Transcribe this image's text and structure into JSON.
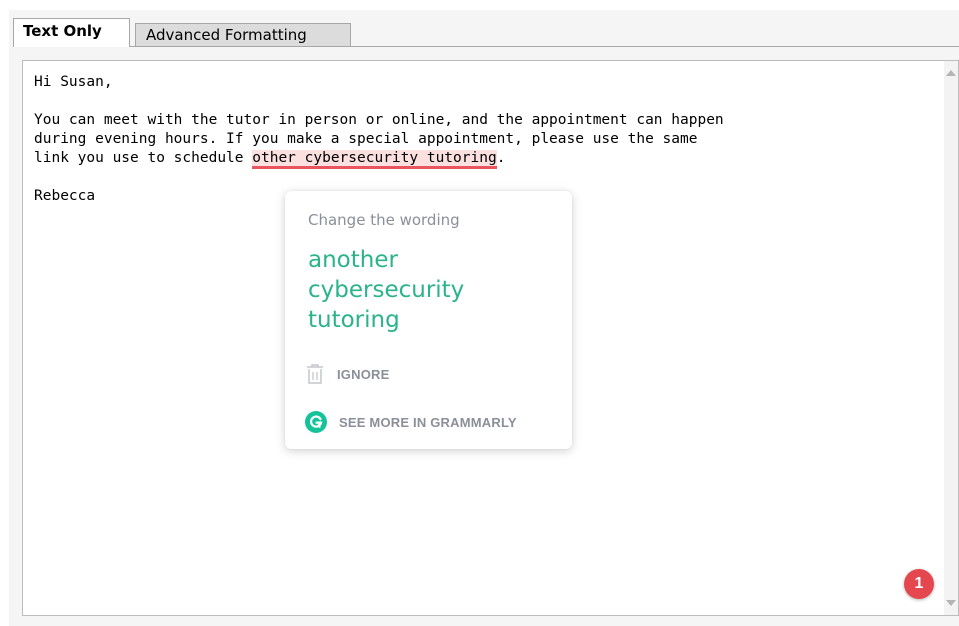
{
  "tabs": [
    {
      "label": "Text Only",
      "active": true
    },
    {
      "label": "Advanced Formatting",
      "active": false
    }
  ],
  "editor": {
    "greeting": "Hi Susan,",
    "body_line1": "You can meet with the tutor in person or online, and the appointment can happen",
    "body_line2": "during evening hours. If you make a special appointment, please use the same",
    "body_line3_prefix": "link you use to schedule ",
    "flagged_phrase": "other cybersecurity tutoring",
    "body_line3_suffix": ".",
    "signature": "Rebecca"
  },
  "suggestion_popup": {
    "title": "Change the wording",
    "suggestion": "another cybersecurity tutoring",
    "ignore_label": "IGNORE",
    "see_more_label": "SEE MORE IN GRAMMARLY"
  },
  "badge": {
    "count": "1"
  },
  "colors": {
    "accent_green": "#2bb38b",
    "grammarly_green": "#15c39a",
    "error_red": "#e9555f",
    "error_highlight": "#fbe0e0",
    "badge_red": "#e5474f"
  },
  "icons": [
    "trash-icon",
    "grammarly-logo-icon",
    "scroll-up-arrow-icon",
    "scroll-down-arrow-icon"
  ]
}
